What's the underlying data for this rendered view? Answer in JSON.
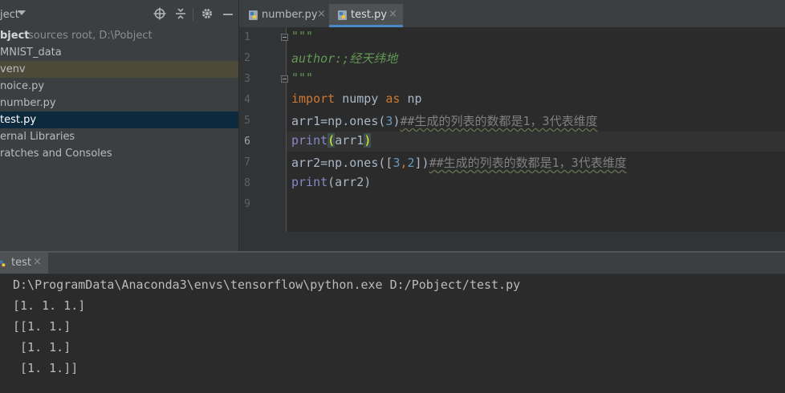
{
  "project_panel": {
    "title": "ject",
    "tree": [
      {
        "label": "bject",
        "secondary": "sources root,  D:\\Pobject"
      },
      {
        "label": "MNIST_data"
      },
      {
        "label": "venv"
      },
      {
        "label": "noice.py"
      },
      {
        "label": "number.py"
      },
      {
        "label": "test.py",
        "selected": true
      },
      {
        "label": "ernal Libraries"
      },
      {
        "label": "ratches and Consoles"
      }
    ]
  },
  "tabs": [
    {
      "label": "number.py",
      "close": "×",
      "active": false
    },
    {
      "label": "test.py",
      "close": "×",
      "active": true
    }
  ],
  "editor": {
    "line_numbers": [
      "1",
      "2",
      "3",
      "4",
      "5",
      "6",
      "7",
      "8",
      "9"
    ],
    "code": {
      "l1": "\"\"\"",
      "l2": "author:;经天纬地",
      "l3": "\"\"\"",
      "l4_kw1": "import",
      "l4_mod": " numpy ",
      "l4_kw2": "as",
      "l4_alias": " np",
      "l5_code": "arr1=np.ones(",
      "l5_num": "3",
      "l5_close": ")",
      "l5_cmt": "##生成的列表的数都是1，3代表维度",
      "l6_fn": "print",
      "l6_open": "(",
      "l6_arg": "arr1",
      "l6_close": ")",
      "l7_code": "arr2=np.ones([",
      "l7_num1": "3",
      "l7_comma": ",",
      "l7_num2": "2",
      "l7_close": "])",
      "l7_cmt": "##生成的列表的数都是1，3代表维度",
      "l8_fn": "print",
      "l8_rest": "(arr2)"
    }
  },
  "run_panel": {
    "tab_label": "test",
    "tab_close": "×",
    "output": [
      "D:\\ProgramData\\Anaconda3\\envs\\tensorflow\\python.exe D:/Pobject/test.py",
      "[1. 1. 1.]",
      "[[1. 1.]",
      " [1. 1.]",
      " [1. 1.]]"
    ]
  },
  "colors": {
    "background": "#2b2b2b",
    "panel": "#3c3f41",
    "keyword": "#cc7832",
    "string": "#629755",
    "number": "#6897bb",
    "builtin": "#8888c6",
    "selection": "#0d293e",
    "tab_underline": "#4a88c7"
  },
  "icons": {
    "dropdown": "triangle-down-icon",
    "locate": "crosshair-icon",
    "collapse": "collapse-icon",
    "settings": "gear-icon",
    "hide": "minimize-icon",
    "python_file": "python-file-icon"
  }
}
